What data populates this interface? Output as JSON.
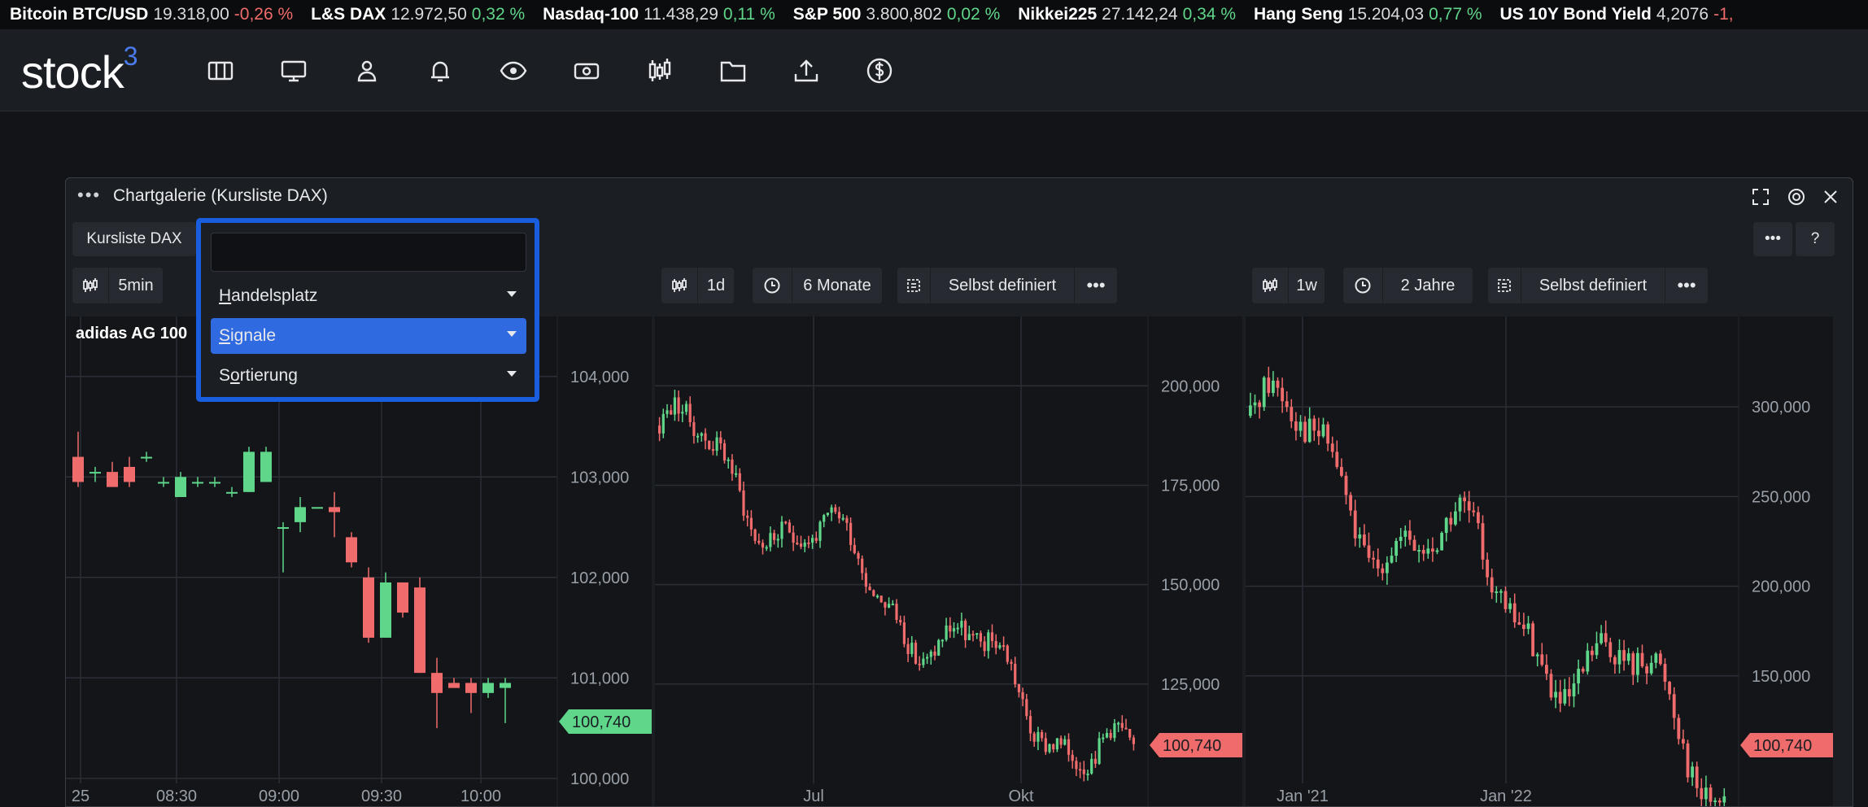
{
  "ticker": [
    {
      "name": "Bitcoin BTC/USD",
      "value": "19.318,00",
      "change": "-0,26 %",
      "dir": "neg"
    },
    {
      "name": "L&S DAX",
      "value": "12.972,50",
      "change": "0,32 %",
      "dir": "pos"
    },
    {
      "name": "Nasdaq-100",
      "value": "11.438,29",
      "change": "0,11 %",
      "dir": "pos"
    },
    {
      "name": "S&P 500",
      "value": "3.800,802",
      "change": "0,02 %",
      "dir": "pos"
    },
    {
      "name": "Nikkei225",
      "value": "27.142,24",
      "change": "0,34 %",
      "dir": "pos"
    },
    {
      "name": "Hang Seng",
      "value": "15.204,03",
      "change": "0,77 %",
      "dir": "pos"
    },
    {
      "name": "US 10Y Bond Yield",
      "value": "4,2076",
      "change": "-1,",
      "dir": "neg"
    }
  ],
  "logo": {
    "text": "stock",
    "sup": "3"
  },
  "nav_icons": [
    "columns-icon",
    "monitor-icon",
    "user-icon",
    "bell-icon",
    "eye-icon",
    "cash-icon",
    "candlestick-icon",
    "folder-icon",
    "upload-icon",
    "dollar-icon"
  ],
  "window": {
    "title": "Chartgalerie (Kursliste DAX)"
  },
  "toolbar": {
    "list_label": "Kursliste DAX",
    "more": "•••",
    "help": "?"
  },
  "panels": [
    {
      "interval": "5min",
      "period": "",
      "style": "",
      "stock": "adidas AG 100",
      "price": "100,740",
      "price_color": "#5fd68a",
      "yticks": [
        "104,000",
        "103,000",
        "102,000",
        "101,000",
        "100,000"
      ],
      "xticks": [
        "25",
        "08:30",
        "09:00",
        "09:30",
        "10:00"
      ]
    },
    {
      "interval": "1d",
      "period": "6 Monate",
      "style": "Selbst definiert",
      "stock": "",
      "price": "100,740",
      "price_color": "#f06b6b",
      "yticks": [
        "200,000",
        "175,000",
        "150,000",
        "125,000"
      ],
      "xticks": [
        "Jul",
        "Okt"
      ]
    },
    {
      "interval": "1w",
      "period": "2 Jahre",
      "style": "Selbst definiert",
      "stock": "",
      "price": "100,740",
      "price_color": "#f06b6b",
      "yticks": [
        "300,000",
        "250,000",
        "200,000",
        "150,000"
      ],
      "xticks": [
        "Jan '21",
        "Jan '22"
      ]
    }
  ],
  "dropdown": {
    "input_value": "",
    "items": [
      {
        "label": "Handelsplatz",
        "active": false,
        "u": "H"
      },
      {
        "label": "Signale",
        "active": true,
        "u": "S"
      },
      {
        "label": "Sortierung",
        "active": false,
        "u": "o"
      }
    ]
  },
  "colors": {
    "up": "#5fd68a",
    "down": "#f06b6b",
    "accent": "#1a5ee0"
  }
}
